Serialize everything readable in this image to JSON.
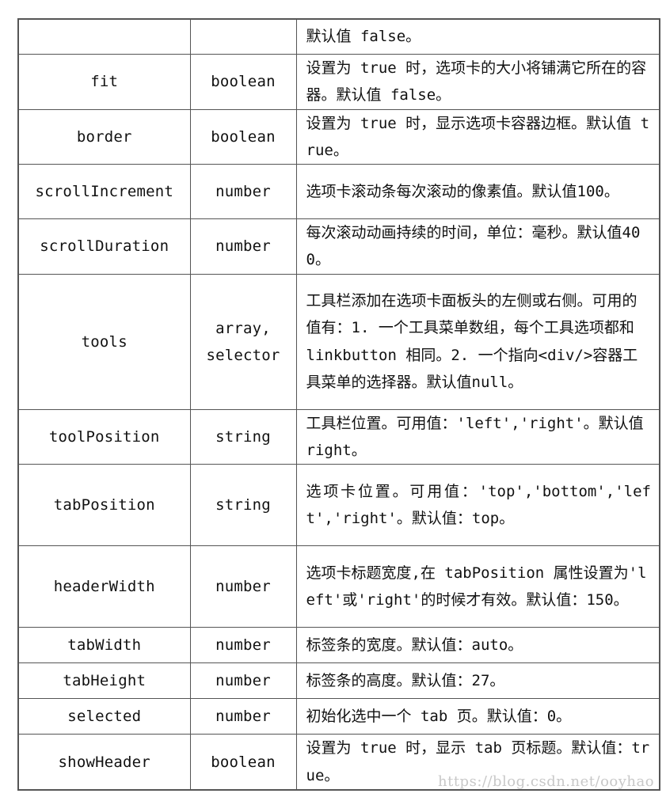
{
  "table": {
    "rows": [
      {
        "name": "",
        "type": [
          ""
        ],
        "desc": "默认值 false。",
        "height": 44
      },
      {
        "name": "fit",
        "type": [
          "boolean"
        ],
        "desc": "设置为 true 时，选项卡的大小将铺满它所在的容器。默认值 false。",
        "height": 70
      },
      {
        "name": "border",
        "type": [
          "boolean"
        ],
        "desc": "设置为 true 时，显示选项卡容器边框。默认值 true。",
        "height": 69
      },
      {
        "name": "scrollIncrement",
        "type": [
          "number"
        ],
        "desc": "选项卡滚动条每次滚动的像素值。默认值100。",
        "height": 69
      },
      {
        "name": "scrollDuration",
        "type": [
          "number"
        ],
        "desc": "每次滚动动画持续的时间，单位：毫秒。默认值400。",
        "height": 69
      },
      {
        "name": "tools",
        "type": [
          "array,",
          "selector"
        ],
        "desc": "工具栏添加在选项卡面板头的左侧或右侧。可用的值有：1. 一个工具菜单数组，每个工具选项都和 linkbutton 相同。2. 一个指向<div/>容器工具菜单的选择器。默认值null。",
        "height": 171
      },
      {
        "name": "toolPosition",
        "type": [
          "string"
        ],
        "desc": "工具栏位置。可用值：'left','right'。默认值 right。",
        "height": 69
      },
      {
        "name": "tabPosition",
        "type": [
          "string"
        ],
        "desc": "选项卡位置。可用值：'top','bottom','left','right'。默认值：top。",
        "height": 103
      },
      {
        "name": "headerWidth",
        "type": [
          "number"
        ],
        "desc": "选项卡标题宽度,在 tabPosition 属性设置为'left'或'right'的时候才有效。默认值：150。",
        "height": 103
      },
      {
        "name": "tabWidth",
        "type": [
          "number"
        ],
        "desc": "标签条的宽度。默认值：auto。",
        "height": 45
      },
      {
        "name": "tabHeight",
        "type": [
          "number"
        ],
        "desc": "标签条的高度。默认值：27。",
        "height": 45
      },
      {
        "name": "selected",
        "type": [
          "number"
        ],
        "desc": "初始化选中一个 tab 页。默认值：0。",
        "height": 45
      },
      {
        "name": "showHeader",
        "type": [
          "boolean"
        ],
        "desc": "设置为 true 时，显示 tab 页标题。默认值：true。",
        "height": 68
      }
    ]
  },
  "watermark": "https://blog.csdn.net/ooyhao"
}
